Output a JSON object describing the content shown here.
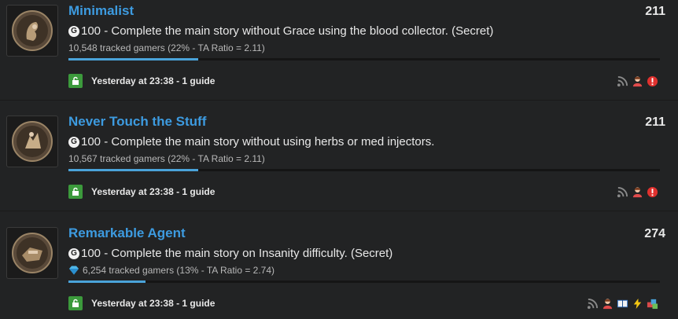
{
  "achievements": [
    {
      "title": "Minimalist",
      "score": "211",
      "gamerscore": "100",
      "description": "- Complete the main story without Grace using the blood collector. (Secret)",
      "tracked": "10,548 tracked gamers (22% - TA Ratio = 2.11)",
      "progress_fraction": 0.22,
      "unlock_time": "Yesterday at 23:38",
      "guides": "1 guide",
      "rarity_icon": null,
      "flag_icons": [
        "rss-icon",
        "multiplayer-icon",
        "missable-icon"
      ]
    },
    {
      "title": "Never Touch the Stuff",
      "score": "211",
      "gamerscore": "100",
      "description": "- Complete the main story without using herbs or med injectors.",
      "tracked": "10,567 tracked gamers (22% - TA Ratio = 2.11)",
      "progress_fraction": 0.22,
      "unlock_time": "Yesterday at 23:38",
      "guides": "1 guide",
      "rarity_icon": null,
      "flag_icons": [
        "rss-icon",
        "multiplayer-icon",
        "missable-icon"
      ]
    },
    {
      "title": "Remarkable Agent",
      "score": "274",
      "gamerscore": "100",
      "description": "- Complete the main story on Insanity difficulty. (Secret)",
      "tracked": "6,254 tracked gamers (13% - TA Ratio = 2.74)",
      "progress_fraction": 0.13,
      "unlock_time": "Yesterday at 23:38",
      "guides": "1 guide",
      "rarity_icon": "diamond-icon",
      "flag_icons": [
        "rss-icon",
        "multiplayer-icon",
        "collectible-icon",
        "speedrun-icon",
        "difficulty-icon"
      ]
    }
  ],
  "gamerscore_badge": "G",
  "colors": {
    "background": "#222324",
    "title": "#3d9be0",
    "progress": "#4aa3d9",
    "unlock_badge": "#3c9a3c",
    "missable": "#e0312e"
  }
}
